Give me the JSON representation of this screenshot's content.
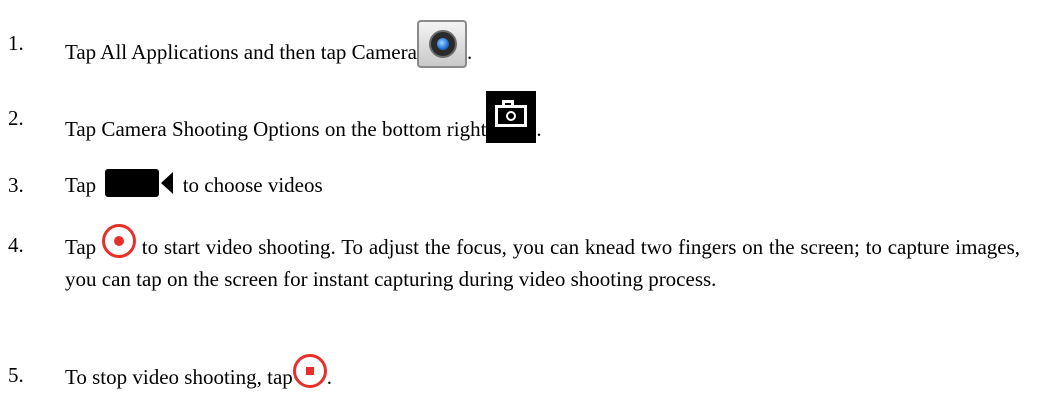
{
  "steps": [
    {
      "number": "1.",
      "text_before": "Tap All Applications and then tap Camera",
      "icon": "camera-app-icon",
      "text_after": "."
    },
    {
      "number": "2.",
      "text_before": "Tap Camera Shooting Options on the bottom right",
      "icon": "camera-shooting-options-icon",
      "text_after": "."
    },
    {
      "number": "3.",
      "text_before": "Tap",
      "icon": "video-camera-icon",
      "text_after": "to choose videos"
    },
    {
      "number": "4.",
      "text_before": "Tap",
      "icon": "record-icon",
      "text_after": "to start video shooting. To adjust the focus, you can knead two fingers on the screen; to capture images, you can tap on the screen for instant capturing during video shooting process."
    },
    {
      "number": "5.",
      "text_before": "To stop video shooting, tap",
      "icon": "stop-record-icon",
      "text_after": "."
    }
  ],
  "colors": {
    "text": "#000000",
    "record_red": "#e8302a",
    "background": "#ffffff"
  }
}
